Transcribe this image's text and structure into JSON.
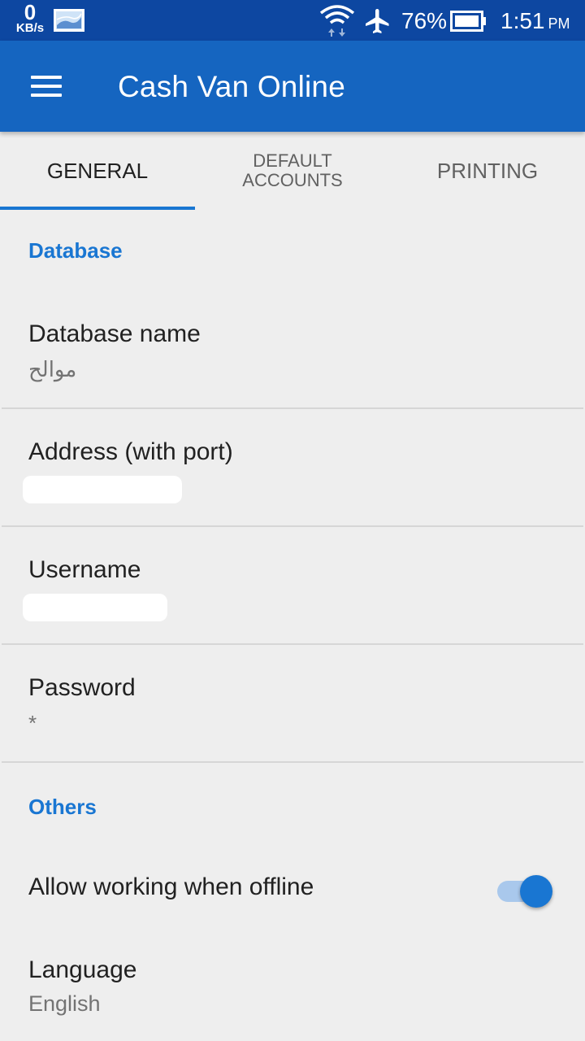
{
  "status_bar": {
    "net_speed_value": "0",
    "net_speed_unit": "KB/s",
    "battery_percent": "76%",
    "time": "1:51",
    "ampm": "PM"
  },
  "app_bar": {
    "title": "Cash Van Online",
    "color": "#1565c0"
  },
  "tabs": [
    {
      "label": "GENERAL",
      "active": true
    },
    {
      "label": "DEFAULT ACCOUNTS",
      "active": false
    },
    {
      "label": "PRINTING",
      "active": false
    }
  ],
  "sections": {
    "database": {
      "title": "Database",
      "database_name": {
        "title": "Database name",
        "value": "موالح"
      },
      "address": {
        "title": "Address (with port)",
        "value": ""
      },
      "username": {
        "title": "Username",
        "value": ""
      },
      "password": {
        "title": "Password",
        "value": "*"
      }
    },
    "others": {
      "title": "Others",
      "offline": {
        "title": "Allow working when offline",
        "enabled": true
      },
      "language": {
        "title": "Language",
        "value": "English"
      }
    }
  },
  "accent_color": "#1976d2"
}
